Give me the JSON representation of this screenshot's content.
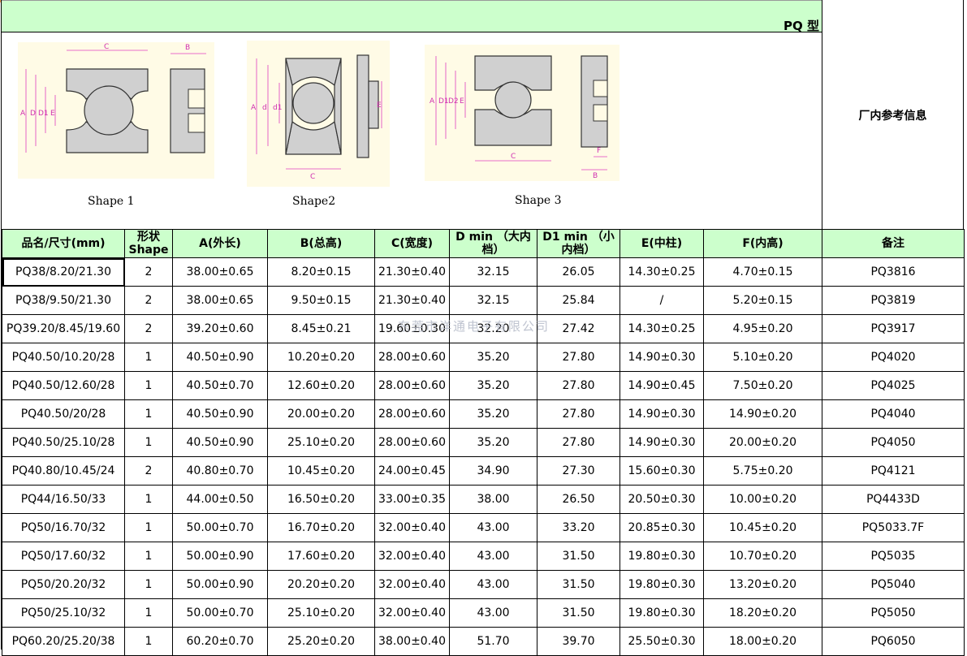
{
  "title": "PQ 型",
  "ref_header": "厂内参考信息",
  "shapes": [
    {
      "label": "Shape 1",
      "dims_side": [
        "C",
        "B"
      ],
      "dims_left": [
        "A",
        "D",
        "D1",
        "E"
      ]
    },
    {
      "label": "Shape2",
      "dims_side": [
        "C",
        "E"
      ],
      "dims_left": [
        "A",
        "d",
        "d1"
      ]
    },
    {
      "label": "Shape 3",
      "dims_side": [
        "C",
        "F",
        "B"
      ],
      "dims_left": [
        "A",
        "D1",
        "D2",
        "E"
      ]
    }
  ],
  "columns": [
    "品名/尺寸(mm)",
    "形状 Shape",
    "A(外长)",
    "B(总高)",
    "C(宽度)",
    "D min （大内档）",
    "D1 min （小内档）",
    "E(中柱)",
    "F(内高)",
    "备注"
  ],
  "rows": [
    [
      "PQ38/8.20/21.30",
      "2",
      "38.00±0.65",
      "8.20±0.15",
      "21.30±0.40",
      "32.15",
      "26.05",
      "14.30±0.25",
      "4.70±0.15",
      "PQ3816"
    ],
    [
      "PQ38/9.50/21.30",
      "2",
      "38.00±0.65",
      "9.50±0.15",
      "21.30±0.40",
      "32.15",
      "25.84",
      "/",
      "5.20±0.15",
      "PQ3819"
    ],
    [
      "PQ39.20/8.45/19.60",
      "2",
      "39.20±0.60",
      "8.45±0.21",
      "19.60±0.30",
      "32.20",
      "27.42",
      "14.30±0.25",
      "4.95±0.20",
      "PQ3917"
    ],
    [
      "PQ40.50/10.20/28",
      "1",
      "40.50±0.90",
      "10.20±0.20",
      "28.00±0.60",
      "35.20",
      "27.80",
      "14.90±0.30",
      "5.10±0.20",
      "PQ4020"
    ],
    [
      "PQ40.50/12.60/28",
      "1",
      "40.50±0.70",
      "12.60±0.20",
      "28.00±0.60",
      "35.20",
      "27.80",
      "14.90±0.45",
      "7.50±0.20",
      "PQ4025"
    ],
    [
      "PQ40.50/20/28",
      "1",
      "40.50±0.90",
      "20.00±0.20",
      "28.00±0.60",
      "35.20",
      "27.80",
      "14.90±0.30",
      "14.90±0.20",
      "PQ4040"
    ],
    [
      "PQ40.50/25.10/28",
      "1",
      "40.50±0.90",
      "25.10±0.20",
      "28.00±0.60",
      "35.20",
      "27.80",
      "14.90±0.30",
      "20.00±0.20",
      "PQ4050"
    ],
    [
      "PQ40.80/10.45/24",
      "2",
      "40.80±0.70",
      "10.45±0.20",
      "24.00±0.45",
      "34.90",
      "27.30",
      "15.60±0.30",
      "5.75±0.20",
      "PQ4121"
    ],
    [
      "PQ44/16.50/33",
      "1",
      "44.00±0.50",
      "16.50±0.20",
      "33.00±0.35",
      "38.00",
      "26.50",
      "20.50±0.30",
      "10.00±0.20",
      "PQ4433D"
    ],
    [
      "PQ50/16.70/32",
      "1",
      "50.00±0.70",
      "16.70±0.20",
      "32.00±0.40",
      "43.00",
      "33.20",
      "20.85±0.30",
      "10.45±0.20",
      "PQ5033.7F"
    ],
    [
      "PQ50/17.60/32",
      "1",
      "50.00±0.90",
      "17.60±0.20",
      "32.00±0.40",
      "43.00",
      "31.50",
      "19.80±0.30",
      "10.70±0.20",
      "PQ5035"
    ],
    [
      "PQ50/20.20/32",
      "1",
      "50.00±0.90",
      "20.20±0.20",
      "32.00±0.40",
      "43.00",
      "31.50",
      "19.80±0.30",
      "13.20±0.20",
      "PQ5040"
    ],
    [
      "PQ50/25.10/32",
      "1",
      "50.00±0.70",
      "25.10±0.20",
      "32.00±0.40",
      "43.00",
      "31.50",
      "19.80±0.30",
      "18.20±0.20",
      "PQ5050"
    ],
    [
      "PQ60.20/25.20/38",
      "1",
      "60.20±0.70",
      "25.20±0.20",
      "38.00±0.40",
      "51.70",
      "39.70",
      "25.50±0.30",
      "18.00±0.20",
      "PQ6050"
    ]
  ],
  "watermark": "东莞市洋通电子有限公司",
  "colors": {
    "header_bg": "#ccffcc",
    "dimension_lines": "#e040c0",
    "figure_bg": "#fffbe6"
  }
}
